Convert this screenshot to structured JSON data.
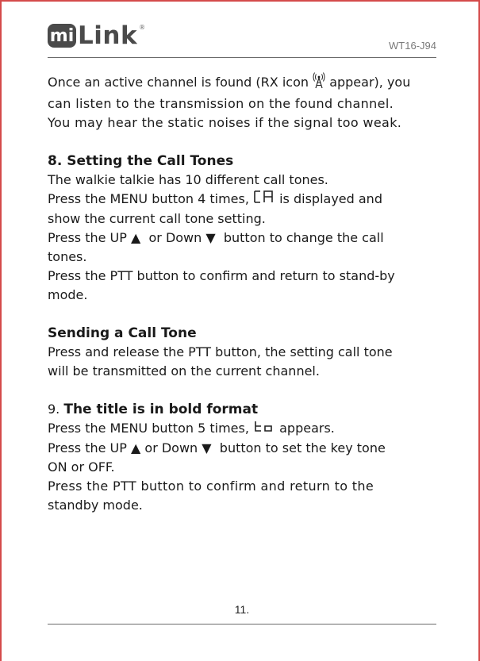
{
  "header": {
    "logo_text": "Link",
    "logo_mi": "mi",
    "logo_reg": "®",
    "model": "WT16-J94"
  },
  "intro": {
    "line1_a": "Once an active channel is found (RX icon",
    "line1_b": "appear), you",
    "line2": "can listen to the transmission on the found channel.",
    "line3": "You may hear the static noises if the signal too weak."
  },
  "section8": {
    "title": "8. Setting the Call Tones",
    "l1": "The walkie talkie has 10 different call tones.",
    "l2_a": "Press the MENU button 4 times,",
    "l2_b": "is displayed and",
    "l3": "show the current call tone setting.",
    "l4_a": "Press the UP",
    "l4_b": "or Down",
    "l4_c": "button to change the call",
    "l5": "tones.",
    "l6": "Press the PTT button to confirm and return to stand-by",
    "l7": "mode."
  },
  "sending": {
    "title": "Sending a Call Tone",
    "l1": "Press and release the PTT button, the setting call tone",
    "l2": "will be transmitted on the current channel."
  },
  "section9": {
    "num": "9.",
    "title": "The title is in bold format",
    "l1_a": "Press the MENU button 5 times,",
    "l1_b": "appears.",
    "l2_a": "Press the UP",
    "l2_b": "or Down",
    "l2_c": "button to set the key tone",
    "l3": "ON or OFF.",
    "l4": "Press the PTT button to confirm and return to the",
    "l5": "standby mode."
  },
  "footer": {
    "page_number": "11."
  },
  "icons": {
    "up": "▲",
    "down": "▼",
    "rx": "rx-antenna-icon",
    "ca_display": "ca-lcd-icon",
    "to_display": "to-lcd-icon"
  },
  "colors": {
    "frame": "#d44a4a",
    "logo": "#4a4a4a"
  }
}
